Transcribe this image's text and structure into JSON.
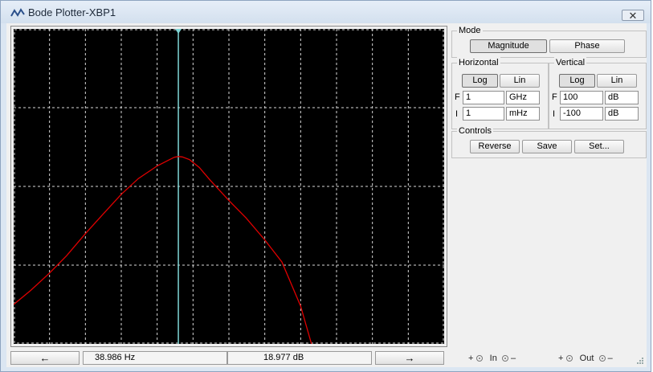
{
  "window": {
    "title": "Bode Plotter-XBP1",
    "close_label": "✕"
  },
  "icons": {
    "app": "bode-plotter-icon",
    "left": "arrow-left-icon",
    "right": "arrow-right-icon"
  },
  "cursor_readout": {
    "frequency": "38.986  Hz",
    "gain": "18.977 dB",
    "left_arrow": "←",
    "right_arrow": "→"
  },
  "controls": {
    "mode": {
      "label": "Mode",
      "magnitude": "Magnitude",
      "phase": "Phase",
      "selected": "Magnitude"
    },
    "horizontal": {
      "label": "Horizontal",
      "log": "Log",
      "lin": "Lin",
      "scale": "Log",
      "final_label": "F",
      "final_value": "1",
      "final_unit": "GHz",
      "initial_label": "I",
      "initial_value": "1",
      "initial_unit": "mHz"
    },
    "vertical": {
      "label": "Vertical",
      "log": "Log",
      "lin": "Lin",
      "scale": "Log",
      "final_label": "F",
      "final_value": "100",
      "final_unit": "dB",
      "initial_label": "I",
      "initial_value": "-100",
      "initial_unit": "dB"
    },
    "controls_group": {
      "label": "Controls",
      "reverse": "Reverse",
      "save": "Save",
      "set": "Set..."
    }
  },
  "terminals": {
    "in": {
      "plus": "+",
      "label": "In",
      "minus": "–"
    },
    "out": {
      "plus": "+",
      "label": "Out",
      "minus": "–"
    }
  },
  "colors": {
    "trace": "#e00000",
    "cursor": "#7fd6d6",
    "grid": "#d8d8d8",
    "background": "#000000"
  },
  "chart_data": {
    "type": "line",
    "x_scale": "log",
    "xlim": [
      0.001,
      1000000000
    ],
    "ylim": [
      -100,
      100
    ],
    "cursor": {
      "x": 38.986,
      "y": 18.977
    },
    "series": [
      {
        "x": [
          0.001,
          0.003,
          0.01,
          0.03,
          0.1,
          0.3,
          1,
          3,
          10,
          20,
          30,
          38.986,
          50,
          80,
          150,
          300,
          1000,
          3000,
          10000,
          30000,
          100000,
          200000
        ],
        "values": [
          -75,
          -66,
          -55,
          -44,
          -30,
          -18,
          -5,
          5,
          13,
          16.5,
          18.5,
          18.977,
          18.7,
          17,
          12,
          4,
          -9,
          -20,
          -34,
          -48,
          -76,
          -100
        ]
      }
    ]
  }
}
